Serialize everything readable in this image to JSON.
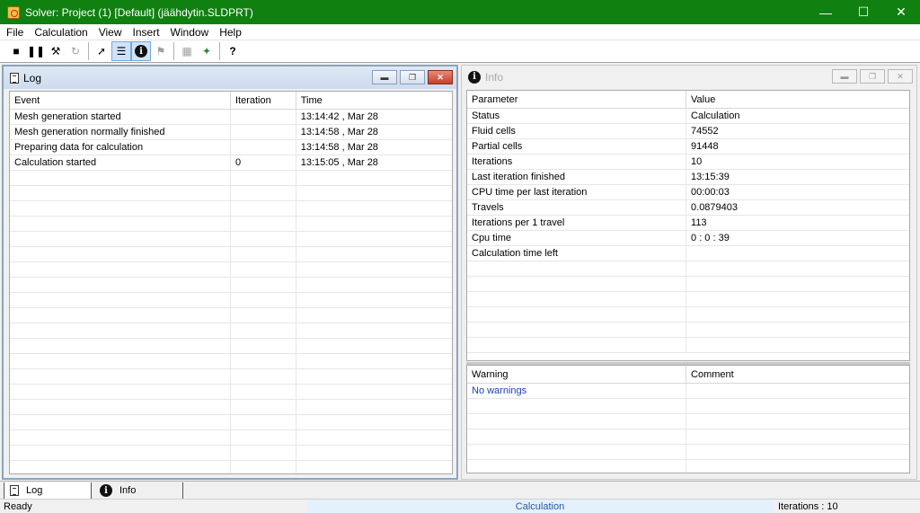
{
  "window": {
    "title": "Solver: Project (1) [Default] (jäähdytin.SLDPRT)"
  },
  "menu": [
    "File",
    "Calculation",
    "View",
    "Insert",
    "Window",
    "Help"
  ],
  "toolbar_icons": [
    "stop-icon",
    "pause-icon",
    "wrench-icon",
    "refresh-icon",
    "pin-icon",
    "log-icon",
    "info-icon",
    "flag-icon",
    "grid-icon",
    "palette-icon",
    "help-icon"
  ],
  "log": {
    "title": "Log",
    "columns": [
      "Event",
      "Iteration",
      "Time"
    ],
    "rows": [
      [
        "Mesh generation started",
        "",
        "13:14:42 , Mar 28"
      ],
      [
        "Mesh generation normally finished",
        "",
        "13:14:58 , Mar 28"
      ],
      [
        "Preparing data for calculation",
        "",
        "13:14:58 , Mar 28"
      ],
      [
        "Calculation started",
        "0",
        "13:15:05 , Mar 28"
      ]
    ]
  },
  "info": {
    "title": "Info",
    "columns": [
      "Parameter",
      "Value"
    ],
    "rows": [
      [
        "Status",
        "Calculation"
      ],
      [
        "Fluid cells",
        "74552"
      ],
      [
        "Partial cells",
        "91448"
      ],
      [
        "Iterations",
        "10"
      ],
      [
        "Last iteration finished",
        "13:15:39"
      ],
      [
        "CPU time per last iteration",
        "00:00:03"
      ],
      [
        "Travels",
        "0.0879403"
      ],
      [
        "Iterations per 1 travel",
        "113"
      ],
      [
        "Cpu time",
        "0 : 0 : 39"
      ],
      [
        "Calculation time left",
        ""
      ]
    ],
    "warning_columns": [
      "Warning",
      "Comment"
    ],
    "warnings": [
      [
        "No warnings",
        ""
      ]
    ]
  },
  "tabs": [
    "Log",
    "Info"
  ],
  "status": {
    "left": "Ready",
    "middle": "Calculation",
    "right": "Iterations : 10"
  }
}
